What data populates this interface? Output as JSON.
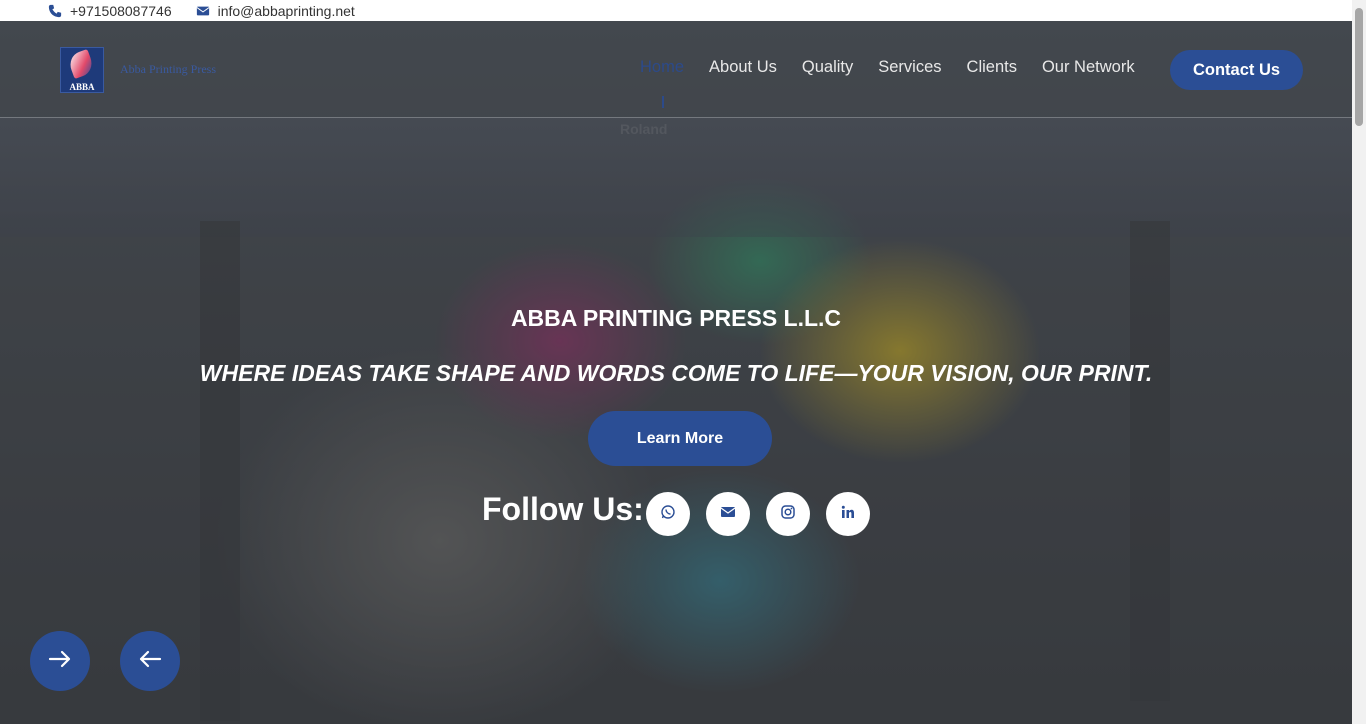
{
  "topbar": {
    "phone": "+971508087746",
    "email": "info@abbaprinting.net",
    "phone_icon": "phone-icon",
    "email_icon": "envelope-icon"
  },
  "logo": {
    "mark_text": "ABBA",
    "wordmark": "Abba Printing Press"
  },
  "nav": {
    "items": [
      {
        "label": "Home",
        "active": true
      },
      {
        "label": "About Us"
      },
      {
        "label": "Quality"
      },
      {
        "label": "Services"
      },
      {
        "label": "Clients"
      },
      {
        "label": "Our Network"
      }
    ],
    "contact_label": "Contact Us"
  },
  "hero": {
    "printer_brand": "Roland",
    "title": "ABBA PRINTING PRESS L.L.C",
    "subtitle": "WHERE IDEAS TAKE SHAPE AND WORDS COME TO LIFE—YOUR VISION, OUR PRINT.",
    "button_label": "Learn More",
    "follow_label": "Follow Us:",
    "social": [
      "whatsapp-icon",
      "envelope-icon",
      "instagram-icon",
      "linkedin-icon"
    ],
    "arrows": [
      "arrow-right-icon",
      "arrow-left-icon"
    ]
  },
  "colors": {
    "brand_blue": "#2b4e95",
    "active_nav": "#2c4a8a",
    "text_light": "#e8e8e8",
    "white": "#ffffff"
  }
}
